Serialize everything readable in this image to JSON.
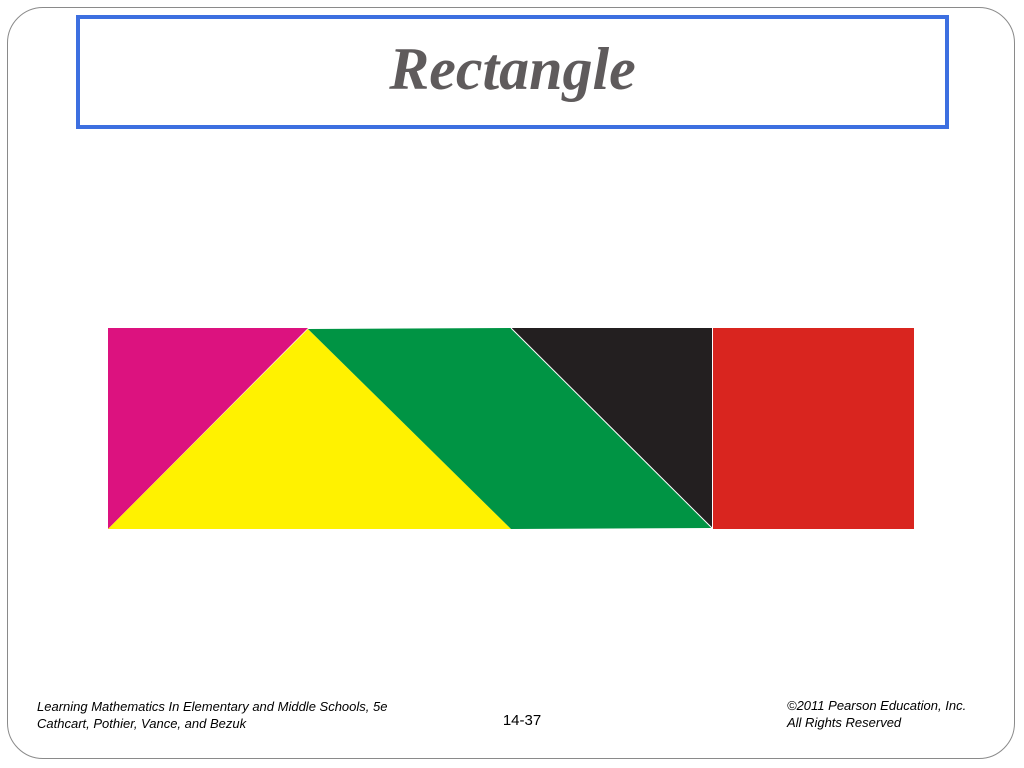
{
  "slide": {
    "title": "Rectangle",
    "footer": {
      "left_line1": "Learning Mathematics In Elementary and Middle Schools, 5e",
      "left_line2": "Cathcart, Pothier, Vance, and Bezuk",
      "page_number": "14-37",
      "right_line1": "©2011 Pearson Education, Inc.",
      "right_line2": "All Rights Reserved"
    }
  },
  "colors": {
    "title_border": "#3d6fe0",
    "title_text": "#5f5b5c",
    "magenta_triangle": "#dc127f",
    "yellow_triangle": "#fff200",
    "green_parallelogram": "#009444",
    "black_triangle": "#231f20",
    "red_square": "#d9251f"
  }
}
